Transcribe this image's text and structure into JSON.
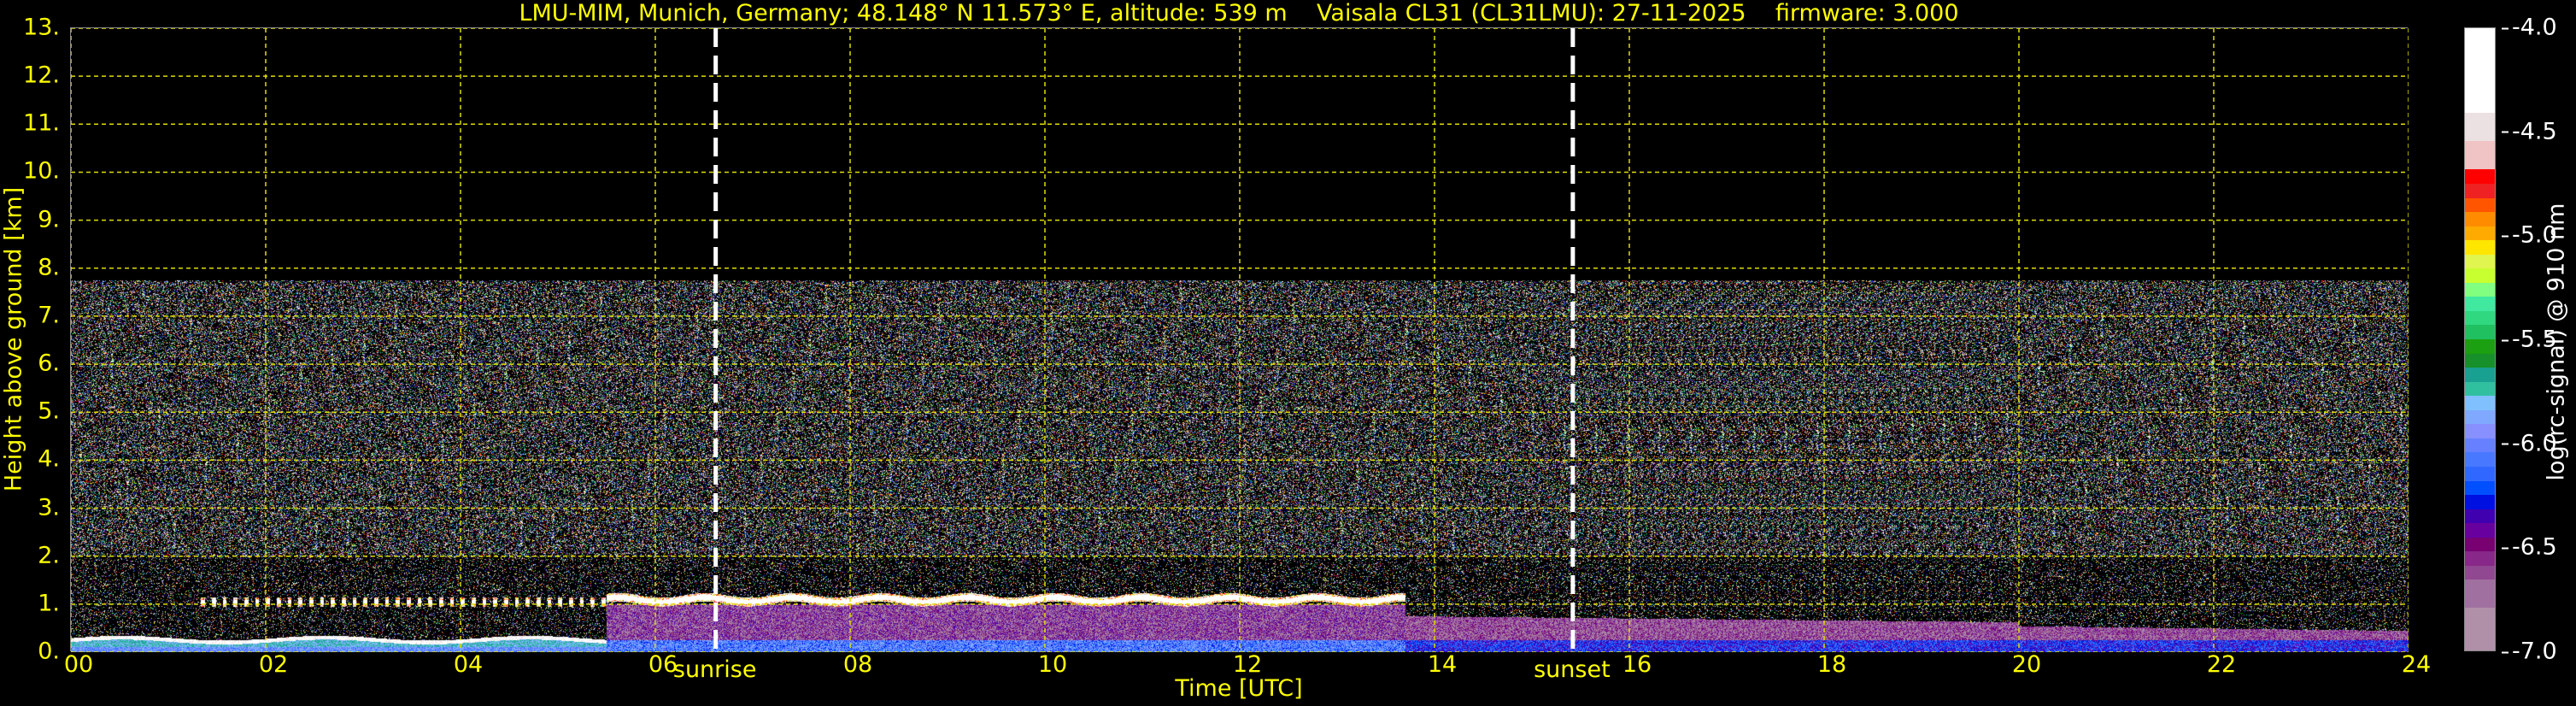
{
  "chart_data": {
    "type": "heatmap",
    "title": "LMU-MIM, Munich, Germany; 48.148° N 11.573° E, altitude: 539 m    Vaisala CL31 (CL31LMU): 27-11-2025    firmware: 3.000",
    "xlabel": "Time [UTC]",
    "ylabel": "Height above ground [km]",
    "xlim": [
      0,
      24
    ],
    "ylim": [
      0,
      13
    ],
    "xticks": [
      "00",
      "02",
      "04",
      "06",
      "08",
      "10",
      "12",
      "14",
      "16",
      "18",
      "20",
      "22",
      "24"
    ],
    "xtick_values": [
      0,
      2,
      4,
      6,
      8,
      10,
      12,
      14,
      16,
      18,
      20,
      22,
      24
    ],
    "yticks": [
      "0.",
      "1.",
      "2.",
      "3.",
      "4.",
      "5.",
      "6.",
      "7.",
      "8.",
      "9.",
      "10.",
      "11.",
      "12.",
      "13."
    ],
    "ytick_values": [
      0,
      1,
      2,
      3,
      4,
      5,
      6,
      7,
      8,
      9,
      10,
      11,
      12,
      13
    ],
    "grid": true,
    "annotations": [
      {
        "label": "sunrise",
        "x": 6.62
      },
      {
        "label": "sunset",
        "x": 15.42
      }
    ],
    "colorbar": {
      "label": "log(rc-signal) @ 910 nm",
      "range": [
        -7.0,
        -4.0
      ],
      "ticks": [
        "-4.0",
        "-4.5",
        "-5.0",
        "-5.5",
        "-6.0",
        "-6.5",
        "-7.0"
      ],
      "tick_values": [
        -4.0,
        -4.5,
        -5.0,
        -5.5,
        -6.0,
        -6.5,
        -7.0
      ],
      "colors": [
        "#ffffff",
        "#ffffff",
        "#ffffff",
        "#ffffff",
        "#ffffff",
        "#ffffff",
        "#ebe0e2",
        "#ebe0e2",
        "#f0c4c4",
        "#f0c4c4",
        "#ff0000",
        "#ee2222",
        "#ff5500",
        "#ff8c00",
        "#ffaa00",
        "#ffe600",
        "#e0f550",
        "#c8ff30",
        "#80ff80",
        "#40e8a0",
        "#30d880",
        "#20c060",
        "#1aa010",
        "#15902a",
        "#18a090",
        "#30c0a0",
        "#80c0ff",
        "#80a8ff",
        "#8890ff",
        "#6680ff",
        "#4878ff",
        "#3068ff",
        "#0050ff",
        "#0010e0",
        "#4000b0",
        "#6800a0",
        "#780070",
        "#882888",
        "#904890",
        "#a070a0",
        "#a070a0",
        "#b090a8",
        "#b090a8",
        "#b090a8"
      ]
    },
    "max_signal_height_km": 7.75,
    "features": [
      {
        "name": "low boundary layer",
        "x": [
          0,
          5.5
        ],
        "top_km": 0.35
      },
      {
        "name": "cloud layer",
        "x": [
          5.5,
          13.7
        ],
        "height_km": 1.1
      },
      {
        "name": "aerosol layer",
        "x": [
          14,
          24
        ],
        "top_km": 0.7
      }
    ]
  }
}
